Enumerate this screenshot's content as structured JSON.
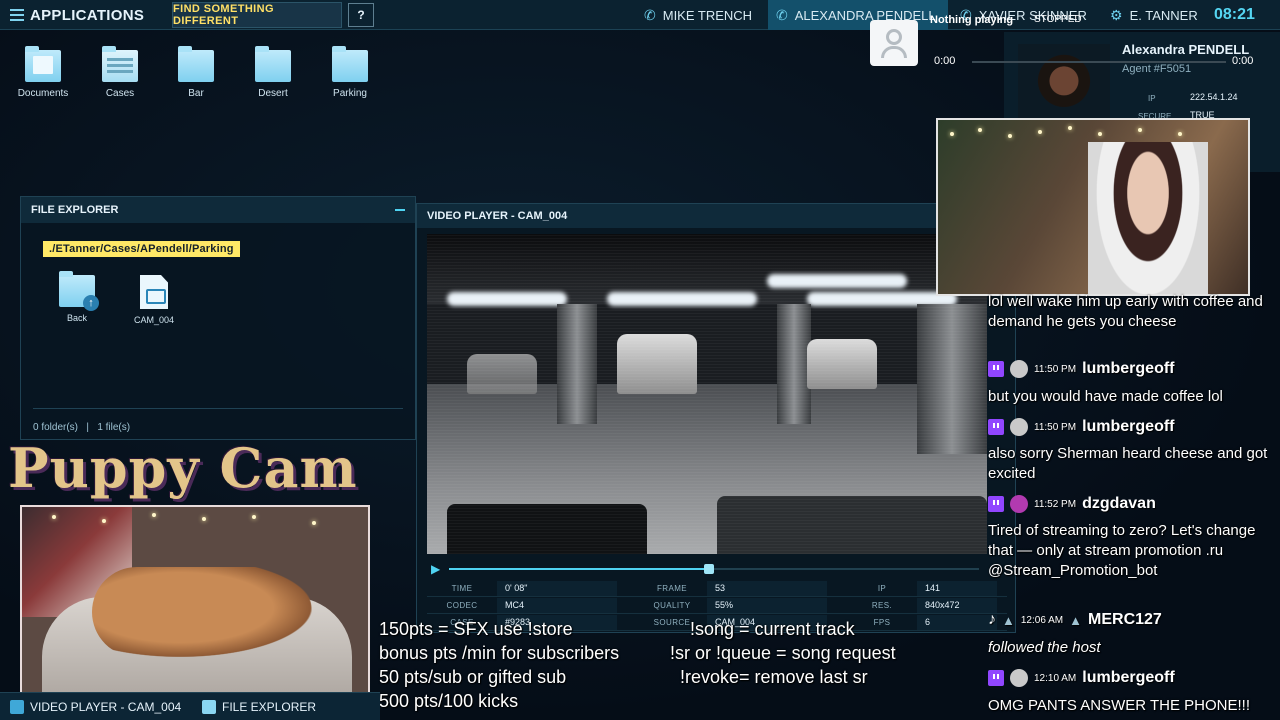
{
  "topbar": {
    "apps_label": "APPLICATIONS",
    "find_label": "Find something different",
    "help_label": "?",
    "contacts": [
      "MIKE TRENCH",
      "ALEXANDRA PENDELL",
      "XAVIER SKINNER",
      "E. TANNER"
    ],
    "clock": "08:21"
  },
  "desktop": {
    "icons": [
      "Documents",
      "Cases",
      "Bar",
      "Desert",
      "Parking"
    ]
  },
  "explorer": {
    "title": "FILE EXPLORER",
    "path": "./ETanner/Cases/APendell/Parking",
    "items": [
      "Back",
      "CAM_004"
    ],
    "folders": "0 folder(s)",
    "sep": "|",
    "files": "1 file(s)"
  },
  "player": {
    "title": "VIDEO PLAYER - CAM_004",
    "progress": 0.49,
    "meta": {
      "time_k": "TIME",
      "time_v": "0' 08\"",
      "frame_k": "FRAME",
      "frame_v": "53",
      "ip_k": "IP",
      "ip_v": "141",
      "codec_k": "CODEC",
      "codec_v": "MC4",
      "quality_k": "QUALITY",
      "quality_v": "55%",
      "res_k": "RES.",
      "res_v": "840x472",
      "case_k": "CASE",
      "case_v": "#9283",
      "source_k": "SOURCE",
      "source_v": "CAM_004",
      "fps_k": "FPS",
      "fps_v": "6"
    }
  },
  "agent": {
    "name": "Alexandra PENDELL",
    "id": "Agent #F5051",
    "ip_k": "IP",
    "ip_v": "222.54.1.24",
    "secure_k": "SECURE",
    "secure_v": "TRUE"
  },
  "now_playing": {
    "title": "Nothing playing",
    "state": "STOPPED",
    "elapsed": "0:00",
    "duration": "0:00"
  },
  "chat": {
    "messages": [
      {
        "user": "",
        "time": "",
        "text": "lol well wake him up early with coffee and demand he gets you cheese"
      },
      {
        "user": "lumbergeoff",
        "time": "11:50 PM",
        "text": "but you would have made coffee lol"
      },
      {
        "user": "lumbergeoff",
        "time": "11:50 PM",
        "text": "also sorry Sherman heard cheese and got excited"
      },
      {
        "user": "dzgdavan",
        "time": "11:52 PM",
        "text": "Tired of streaming to zero? Let's change that — only at stream promotion .ru @Stream_Promotion_bot"
      },
      {
        "user": "MERC127",
        "time": "12:06 AM",
        "text": "followed the host"
      },
      {
        "user": "lumbergeoff",
        "time": "12:10 AM",
        "text": "OMG PANTS ANSWER THE PHONE!!!"
      }
    ]
  },
  "stream": {
    "puppy_title": "Puppy Cam",
    "left_lines": [
      "150pts = SFX use !store",
      "bonus pts /min for subscribers",
      "50 pts/sub or gifted sub",
      "500 pts/100 kicks"
    ],
    "right_lines": [
      "!song = current track",
      "!sr or !queue = song request",
      "!revoke= remove last sr"
    ]
  },
  "taskbar": {
    "items": [
      "VIDEO PLAYER - CAM_004",
      "FILE EXPLORER"
    ]
  }
}
